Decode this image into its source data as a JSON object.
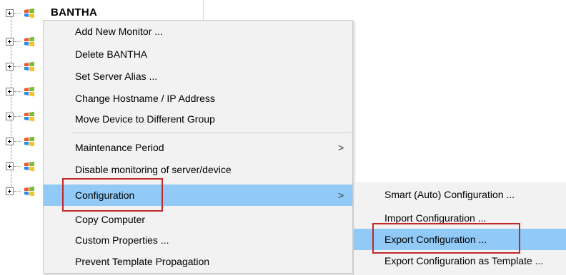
{
  "tree": {
    "root_label": "BANTHA",
    "node_count": 8,
    "os_icon": "windows-logo-icon",
    "expander_icon": "plus-box-icon"
  },
  "context_menu": {
    "items": [
      {
        "label": "Add New Monitor ..."
      },
      {
        "label": "Delete BANTHA"
      },
      {
        "label": "Set Server Alias ..."
      },
      {
        "label": "Change Hostname / IP Address"
      },
      {
        "label": "Move Device to Different Group"
      },
      {
        "label": "Maintenance Period",
        "submenu_arrow": ">"
      },
      {
        "label": "Disable monitoring of server/device"
      },
      {
        "label": "Configuration",
        "submenu_arrow": ">",
        "highlighted": true
      },
      {
        "label": "Copy Computer"
      },
      {
        "label": "Custom Properties ..."
      },
      {
        "label": "Prevent Template Propagation"
      }
    ]
  },
  "submenu": {
    "items": [
      {
        "label": "Smart (Auto) Configuration ..."
      },
      {
        "label": "Import Configuration ..."
      },
      {
        "label": "Export Configuration ...",
        "highlighted": true
      },
      {
        "label": "Export Configuration as Template ..."
      }
    ]
  },
  "colors": {
    "highlight": "#91c9f7",
    "menu_bg": "#f2f2f2",
    "annotation_red": "#c0282c"
  }
}
